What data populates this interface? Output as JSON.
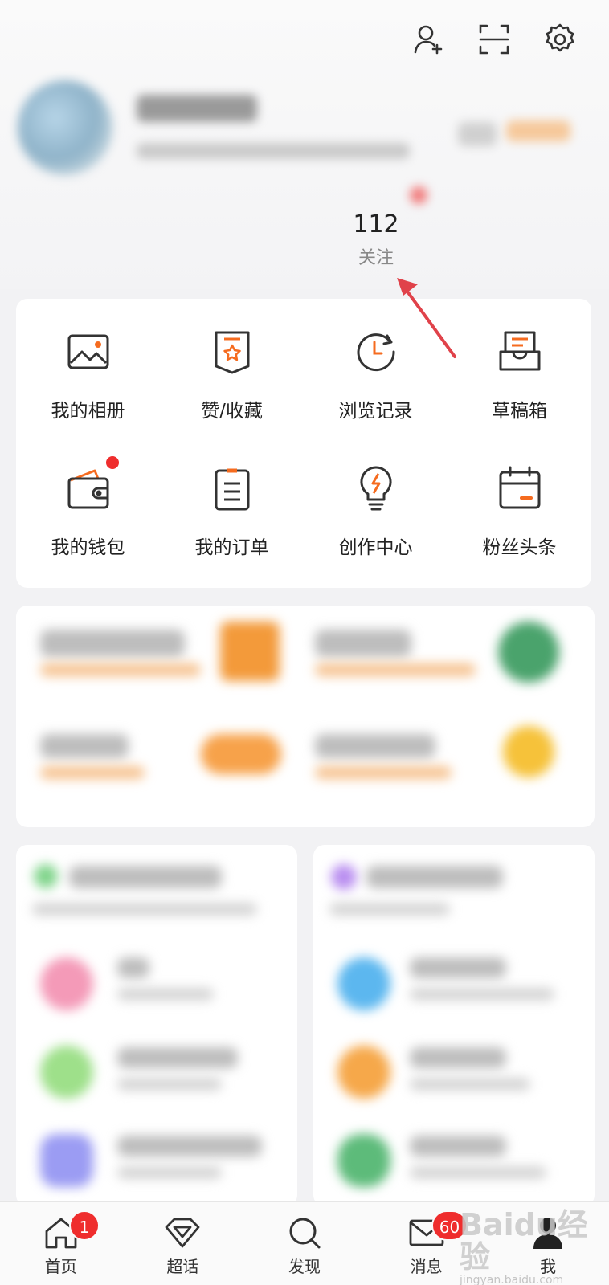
{
  "top_icons": [
    "add-friend-icon",
    "scan-icon",
    "settings-icon"
  ],
  "stats": [
    {
      "count": "",
      "label": ""
    },
    {
      "count": "",
      "label": ""
    },
    {
      "count": "112",
      "label": "关注"
    },
    {
      "count": "",
      "label": ""
    }
  ],
  "menu": [
    {
      "label": "我的相册",
      "icon": "album-icon"
    },
    {
      "label": "赞/收藏",
      "icon": "like-collect-icon"
    },
    {
      "label": "浏览记录",
      "icon": "history-icon"
    },
    {
      "label": "草稿箱",
      "icon": "drafts-icon"
    },
    {
      "label": "我的钱包",
      "icon": "wallet-icon"
    },
    {
      "label": "我的订单",
      "icon": "orders-icon"
    },
    {
      "label": "创作中心",
      "icon": "creator-center-icon"
    },
    {
      "label": "粉丝头条",
      "icon": "fans-headline-icon"
    }
  ],
  "tabbar": [
    {
      "label": "首页",
      "badge": "1",
      "icon": "home-icon"
    },
    {
      "label": "超话",
      "badge": "",
      "icon": "diamond-icon"
    },
    {
      "label": "发现",
      "badge": "",
      "icon": "search-icon"
    },
    {
      "label": "消息",
      "badge": "60",
      "icon": "mail-icon"
    },
    {
      "label": "我",
      "badge": "",
      "icon": "profile-icon"
    }
  ],
  "watermark": {
    "brand": "Baidu经验",
    "url": "jingyan.baidu.com"
  },
  "colors": {
    "accent": "#f56b1f",
    "badge": "#ef2d2d",
    "arrow": "#e0424a"
  }
}
